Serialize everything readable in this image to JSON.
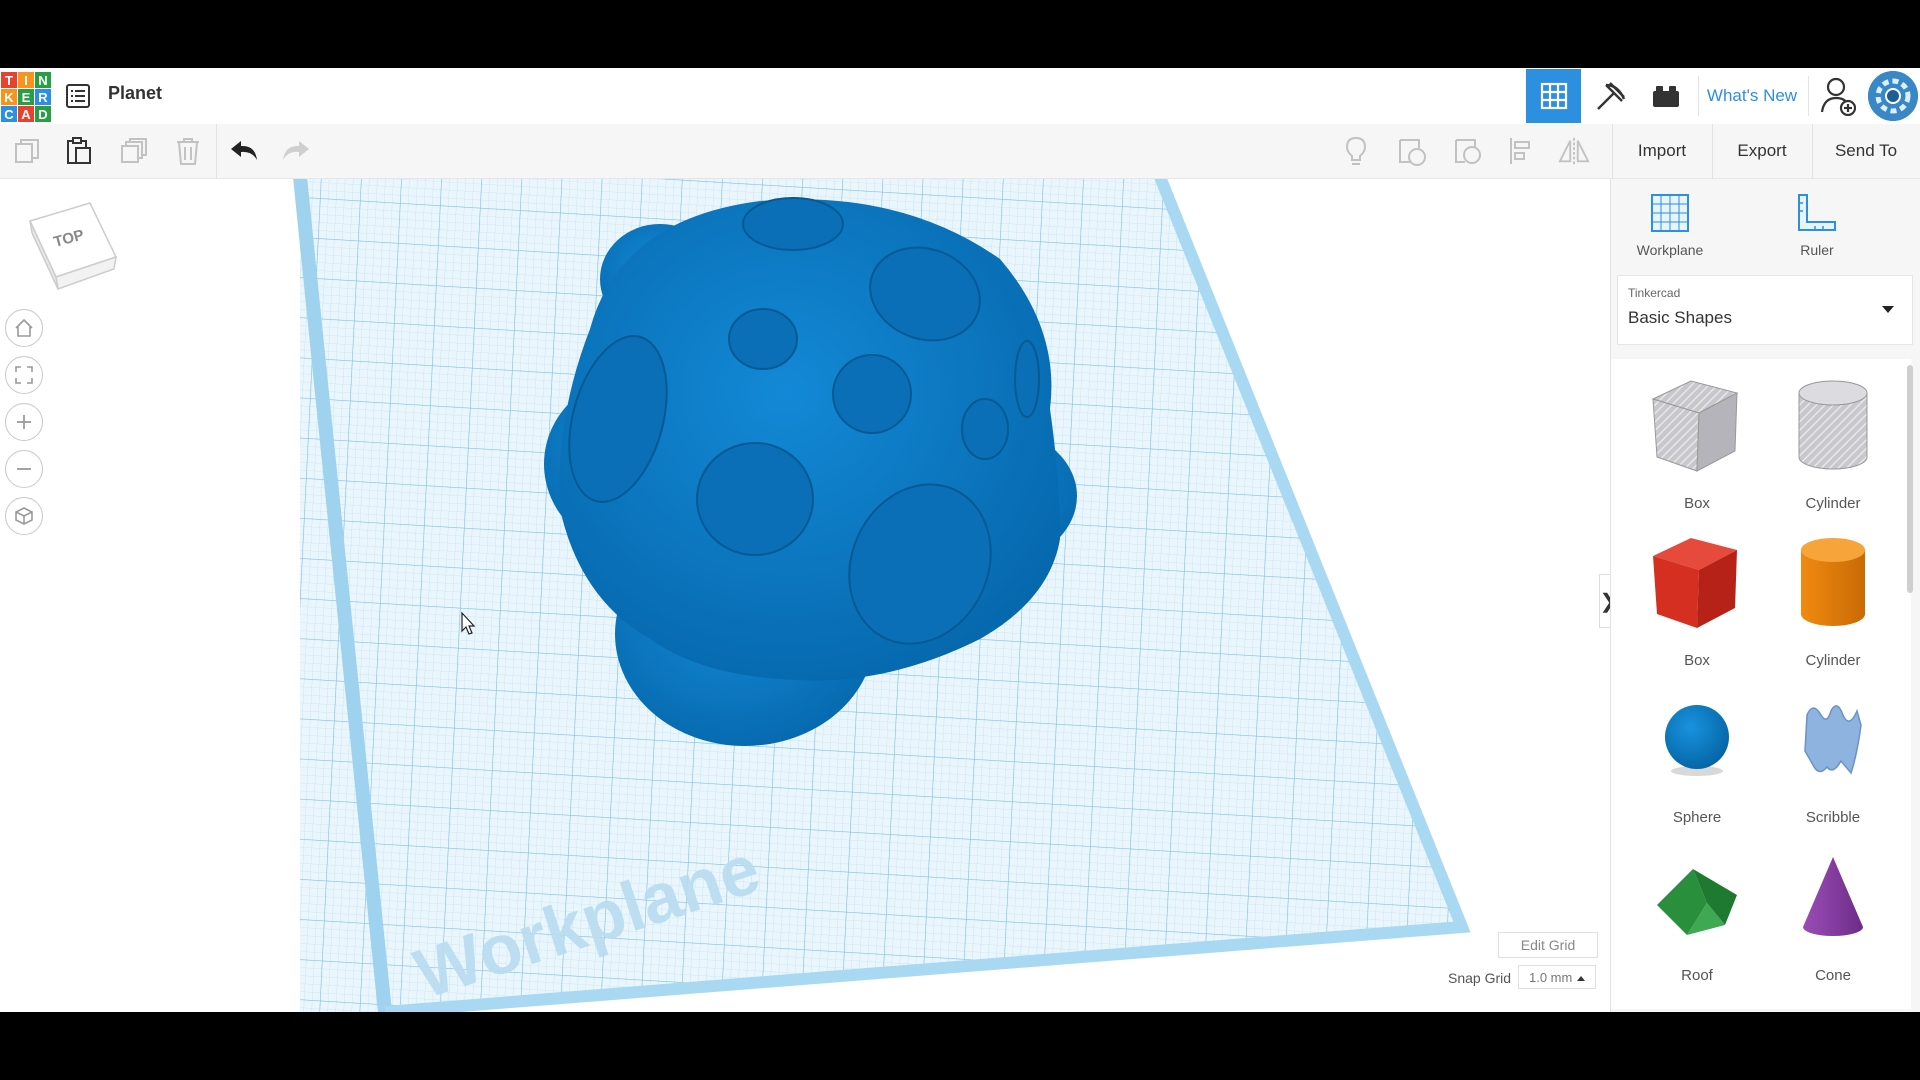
{
  "app": {
    "logo_letters": [
      "T",
      "I",
      "N",
      "K",
      "E",
      "R",
      "C",
      "A",
      "D"
    ],
    "logo_colors": [
      "#e8412e",
      "#f7941d",
      "#2a9d46",
      "#f7941d",
      "#2a9d46",
      "#2d8fe0",
      "#2d8fe0",
      "#e8412e",
      "#2a9d46"
    ],
    "title": "Planet"
  },
  "header": {
    "grid_view_icon": "3d-design-grid-icon",
    "pickaxe_icon": "minecraft-pickaxe-icon",
    "bricks_icon": "lego-bricks-icon",
    "whats_new_label": "What's New",
    "user_icon": "add-user-icon",
    "accent": "#2d8fe0"
  },
  "toolbar": {
    "copy_icon": "copy-icon",
    "paste_icon": "paste-icon",
    "duplicate_icon": "duplicate-icon",
    "delete_icon": "trash-icon",
    "undo_icon": "undo-icon",
    "redo_icon": "redo-icon",
    "import_label": "Import",
    "export_label": "Export",
    "send_to_label": "Send To"
  },
  "canvas": {
    "viewcube_label": "TOP",
    "workplane_watermark": "Workplane",
    "edit_grid_label": "Edit Grid",
    "snap_grid_label": "Snap Grid",
    "snap_grid_value": "1.0 mm",
    "object_color": "#0b77c2",
    "grid_color": "#a9d9f2"
  },
  "panel": {
    "workplane_label": "Workplane",
    "ruler_label": "Ruler",
    "library_source": "Tinkercad",
    "library_name": "Basic Shapes",
    "shapes": [
      {
        "label": "Box",
        "icon": "box-hole-icon"
      },
      {
        "label": "Cylinder",
        "icon": "cylinder-hole-icon"
      },
      {
        "label": "Box",
        "icon": "box-icon"
      },
      {
        "label": "Cylinder",
        "icon": "cylinder-icon"
      },
      {
        "label": "Sphere",
        "icon": "sphere-icon"
      },
      {
        "label": "Scribble",
        "icon": "scribble-icon"
      },
      {
        "label": "Roof",
        "icon": "roof-icon"
      },
      {
        "label": "Cone",
        "icon": "cone-icon"
      }
    ]
  }
}
